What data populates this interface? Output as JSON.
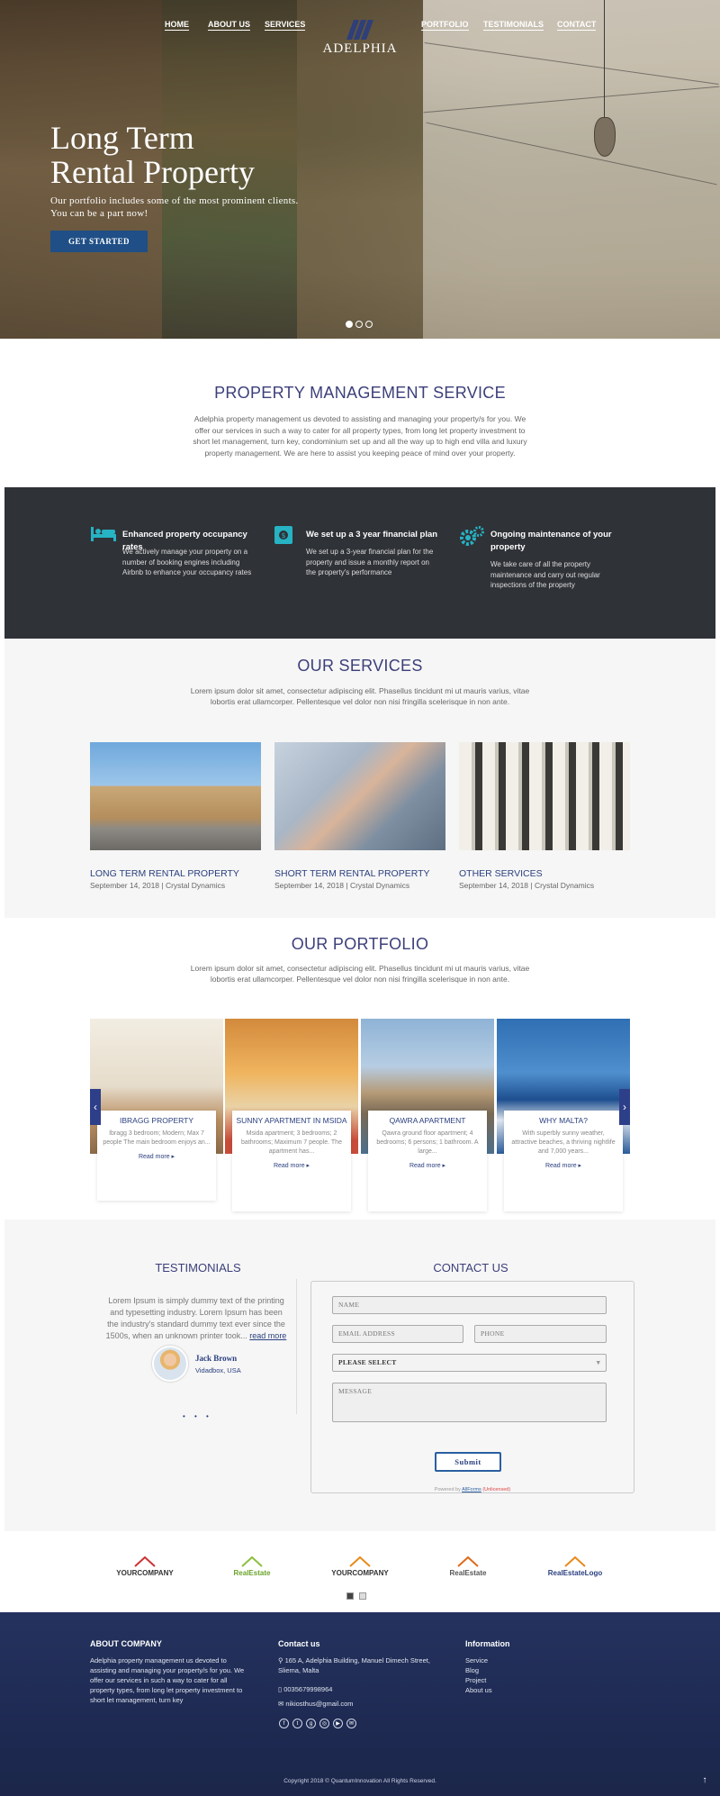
{
  "nav": {
    "home": "HOME",
    "about": "ABOUT US",
    "services": "SERVICES",
    "portfolio": "PORTFOLIO",
    "testimonials": "TESTIMONIALS",
    "contact": "CONTACT",
    "logo_text": "ADELPHIA"
  },
  "hero": {
    "title_line1": "Long Term",
    "title_line2": "Rental Property",
    "subtitle_line1": "Our portfolio includes some of the most prominent clients.",
    "subtitle_line2": "You can be a part now!",
    "cta": "GET STARTED",
    "slides": 3,
    "active_slide": 1
  },
  "pms": {
    "title": "PROPERTY MANAGEMENT SERVICE",
    "text": "Adelphia property management us devoted to assisting and managing your property/s for you. We offer our services in such a way to cater for all property types, from long let property investment to short let management, turn key, condominium set up and all the way up to high end villa and luxury property management. We are here to assist you keeping peace of mind over your property."
  },
  "features": [
    {
      "icon": "bed-icon",
      "title": "Enhanced property occupancy rates",
      "text": "We actively manage your property on a number of booking engines including Airbnb to enhance your occupancy rates"
    },
    {
      "icon": "money-icon",
      "title": "We set up a 3 year financial plan",
      "text": "We set up a 3-year financial plan for the property and issue a monthly report on the property's performance"
    },
    {
      "icon": "gears-icon",
      "title": "Ongoing maintenance of your property",
      "text": "We take care of all the property maintenance and carry out regular inspections of the property"
    }
  ],
  "services": {
    "title": "OUR SERVICES",
    "lead": "Lorem ipsum dolor sit amet, consectetur adipiscing elit. Phasellus tincidunt mi ut mauris varius, vitae lobortis erat ullamcorper. Pellentesque vel dolor non nisi fringilla scelerisque in non ante.",
    "items": [
      {
        "title": "LONG TERM RENTAL PROPERTY",
        "meta": "September 14, 2018 | Crystal Dynamics"
      },
      {
        "title": "SHORT TERM RENTAL PROPERTY",
        "meta": "September 14, 2018 | Crystal Dynamics"
      },
      {
        "title": "OTHER SERVICES",
        "meta": "September 14, 2018 | Crystal Dynamics"
      }
    ]
  },
  "portfolio": {
    "title": "OUR PORTFOLIO",
    "lead": "Lorem ipsum dolor sit amet, consectetur adipiscing elit. Phasellus tincidunt mi ut mauris varius, vitae lobortis erat ullamcorper. Pellentesque vel dolor non nisi fringilla scelerisque in non ante.",
    "read_more": "Read more ▸",
    "items": [
      {
        "title": "IBRAGG PROPERTY",
        "text": "Ibragg 3 bedroom; Modern; Max 7 people The main bedroom enjoys an..."
      },
      {
        "title": "SUNNY APARTMENT IN MSIDA",
        "text": "Msida apartment; 3 bedrooms; 2 bathrooms; Maximum 7 people. The apartment has..."
      },
      {
        "title": "QAWRA APARTMENT",
        "text": "Qawra ground floor apartment; 4 bedrooms; 6 persons; 1 bathroom. A large..."
      },
      {
        "title": "WHY MALTA?",
        "text": "With superbly sunny weather, attractive beaches, a thriving nightlife and 7,000 years..."
      }
    ]
  },
  "testimonials": {
    "title": "TESTIMONIALS",
    "quote": "Lorem Ipsum is simply dummy text of the printing and typesetting industry. Lorem Ipsum has been the industry's standard dummy text ever since the 1500s, when an unknown printer took...",
    "read_more": "read more",
    "name": "Jack Brown",
    "location": "Vidadbox, USA",
    "dots": "• • •"
  },
  "contact": {
    "title": "CONTACT US",
    "name_ph": "Name",
    "email_ph": "Email Address",
    "phone_ph": "Phone",
    "select_value": "Please select",
    "message_ph": "Message",
    "submit": "Submit",
    "powered_prefix": "Powered by",
    "powered_brand": "AllForms",
    "powered_suffix": "(Unlicensed)"
  },
  "logos": [
    "YOURCOMPANY",
    "RealEstate",
    "YOURCOMPANY",
    "RealEstate",
    "RealEstateLogo"
  ],
  "footer": {
    "about_title": "ABOUT COMPANY",
    "about_text": "Adelphia property management us devoted to assisting and managing your property/s for you. We offer our services in such a way to cater for all property types, from long let property investment to short let management, turn key",
    "contact_title": "Contact us",
    "address": "165 A, Adelphia Building, Manuel Dimech Street, Sliema, Malta",
    "phone": "0035679998964",
    "email": "nikiosthus@gmail.com",
    "info_title": "Information",
    "links": [
      "Service",
      "Blog",
      "Project",
      "About us"
    ],
    "copyright": "Copyright 2018 © QuantumInnovation All Rights Reserved."
  },
  "colors": {
    "accent": "#2a3f7f",
    "cta": "#1f4f86",
    "footer": "#24325e",
    "features_bg": "#2f3237",
    "icon": "#26b3c4"
  }
}
